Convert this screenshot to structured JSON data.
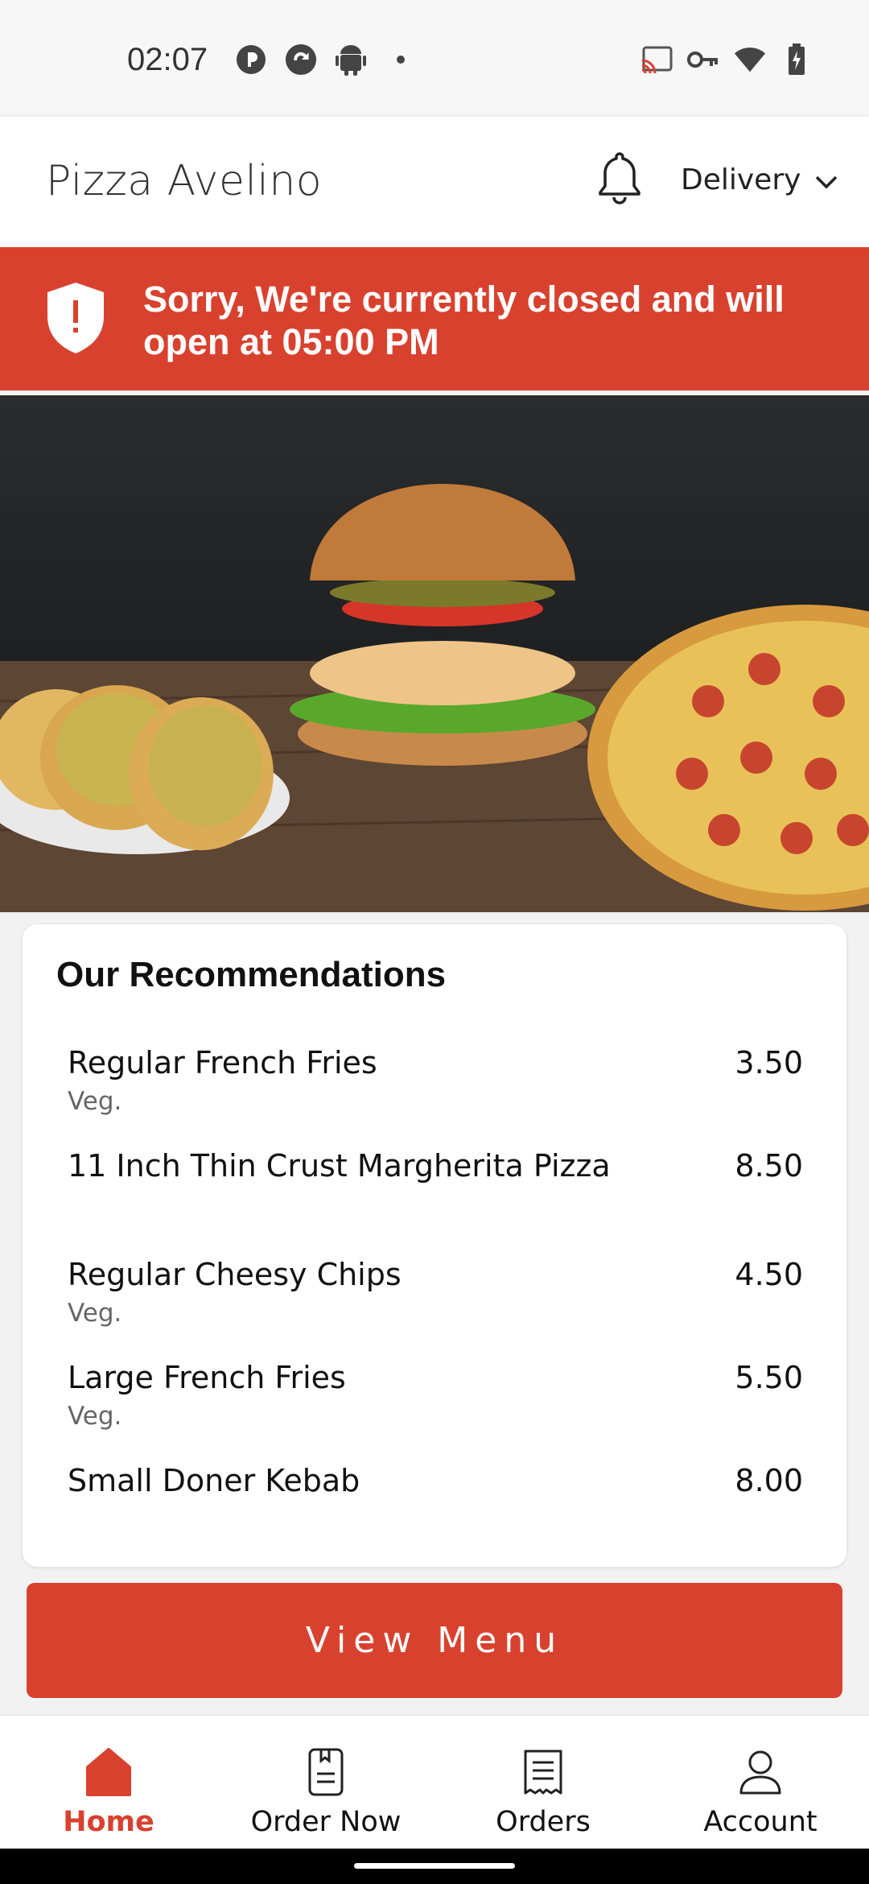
{
  "status_bar": {
    "time": "02:07",
    "left_icons": [
      "p-circle-icon",
      "sync-circle-icon",
      "android-icon",
      "dot-icon"
    ],
    "right_icons": [
      "cast-icon",
      "key-icon",
      "wifi-icon",
      "battery-charging-icon"
    ]
  },
  "header": {
    "title": "Pizza Avelino",
    "bell_icon": "bell-icon",
    "order_mode": "Delivery"
  },
  "closed_banner": {
    "message": "Sorry, We're currently closed and will open at 05:00 PM",
    "icon": "shield-alert-icon",
    "color": "#d9412f"
  },
  "recommendations": {
    "title": "Our Recommendations",
    "items": [
      {
        "name": "Regular French Fries",
        "tag": "Veg.",
        "price": "3.50"
      },
      {
        "name": "11 Inch Thin Crust Margherita Pizza",
        "tag": "",
        "price": "8.50"
      },
      {
        "name": "Regular Cheesy Chips",
        "tag": "Veg.",
        "price": "4.50"
      },
      {
        "name": "Large French Fries",
        "tag": "Veg.",
        "price": "5.50"
      },
      {
        "name": "Small Doner Kebab",
        "tag": "",
        "price": "8.00"
      }
    ]
  },
  "view_menu_label": "View Menu",
  "bottom_nav": {
    "items": [
      {
        "label": "Home",
        "icon": "home-icon",
        "active": true
      },
      {
        "label": "Order Now",
        "icon": "order-now-icon",
        "active": false
      },
      {
        "label": "Orders",
        "icon": "receipt-icon",
        "active": false
      },
      {
        "label": "Account",
        "icon": "person-icon",
        "active": false
      }
    ]
  },
  "colors": {
    "accent": "#d9412f",
    "background": "#f2f2f2"
  }
}
